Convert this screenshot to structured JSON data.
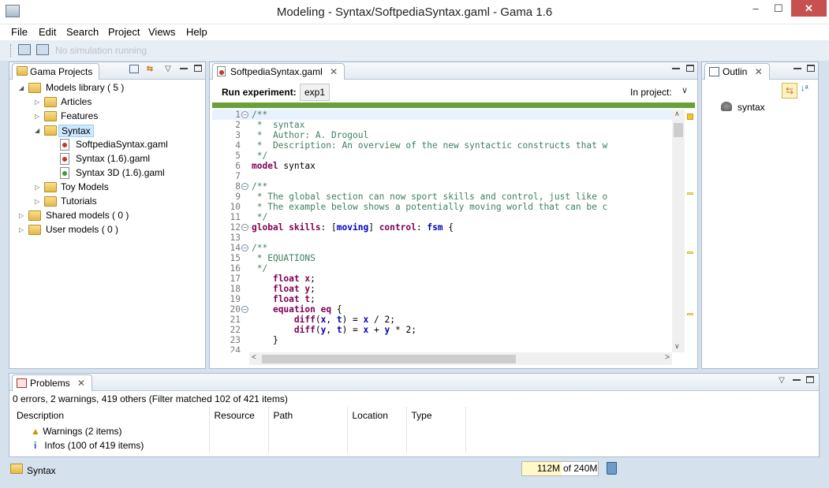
{
  "window": {
    "title": "Modeling - Syntax/SoftpediaSyntax.gaml - Gama 1.6",
    "min": "–",
    "max": "☐",
    "close": "✕"
  },
  "menu": [
    "File",
    "Edit",
    "Search",
    "Project",
    "Views",
    "Help"
  ],
  "toolbar": {
    "status": "No simulation running"
  },
  "projects": {
    "tab": "Gama Projects",
    "tree": [
      {
        "label": "Models library ( 5 )"
      },
      {
        "label": "Articles"
      },
      {
        "label": "Features"
      },
      {
        "label": "Syntax"
      },
      {
        "label": "SoftpediaSyntax.gaml"
      },
      {
        "label": "Syntax (1.6).gaml"
      },
      {
        "label": "Syntax 3D (1.6).gaml"
      },
      {
        "label": "Toy Models"
      },
      {
        "label": "Tutorials"
      },
      {
        "label": "Shared models ( 0 )"
      },
      {
        "label": "User models ( 0 )"
      }
    ]
  },
  "editor": {
    "tab": "SoftpediaSyntax.gaml",
    "run_label": "Run experiment:",
    "run_button": "exp1",
    "in_project": "In project:",
    "line_numbers": [
      "1",
      "2",
      "3",
      "4",
      "5",
      "6",
      "7",
      "8",
      "9",
      "10",
      "11",
      "12",
      "13",
      "14",
      "15",
      "16",
      "17",
      "18",
      "19",
      "20",
      "21",
      "22",
      "23",
      "24"
    ]
  },
  "outline": {
    "tab": "Outlin",
    "item": "syntax"
  },
  "problems": {
    "tab": "Problems",
    "summary": "0 errors, 2 warnings, 419 others (Filter matched 102 of 421 items)",
    "columns": [
      "Description",
      "Resource",
      "Path",
      "Location",
      "Type"
    ],
    "rows": [
      "Warnings (2 items)",
      "Infos (100 of 419 items)"
    ]
  },
  "status": {
    "project": "Syntax",
    "mem_used": "112M",
    "mem_total": "of 240M"
  },
  "colors": {
    "accent_green": "#6aa039",
    "keyword": "#7f0055",
    "comment": "#3f7f5f",
    "variable": "#0000c0"
  }
}
